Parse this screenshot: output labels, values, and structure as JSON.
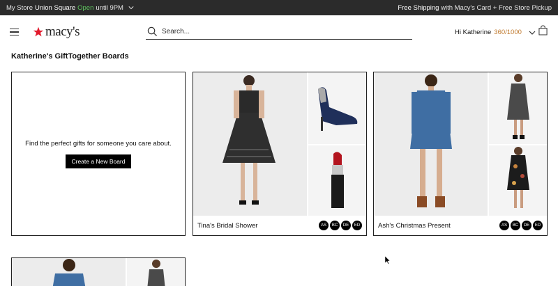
{
  "topbar": {
    "store_prefix": "My Store",
    "store_name": "Union Square",
    "status": "Open",
    "hours": "until 9PM",
    "shipping_strong": "Free Shipping",
    "shipping_rest": "with Macy's Card + Free Store Pickup"
  },
  "header": {
    "logo_text": "macy's",
    "search_placeholder": "Search...",
    "greeting": "Hi Katherine",
    "points": "360/1000"
  },
  "page": {
    "title": "Katherine's GiftTogether Boards"
  },
  "new_board": {
    "prompt": "Find the perfect gifts for someone you care about.",
    "button_label": "Create a New Board"
  },
  "boards": [
    {
      "name": "Tina's Bridal Shower",
      "members": [
        "AS",
        "BC",
        "DE",
        "ED"
      ]
    },
    {
      "name": "Ash's Christmas Present",
      "members": [
        "AS",
        "BC",
        "DE",
        "ED"
      ]
    }
  ],
  "colors": {
    "topbar_bg": "#2b2b2b",
    "open_green": "#5ec45e",
    "brand_red": "#e21a2c",
    "points_orange": "#c0792d"
  },
  "icons": [
    "hamburger-menu-icon",
    "macys-star-icon",
    "search-icon",
    "chevron-down-icon",
    "shopping-bag-icon"
  ]
}
